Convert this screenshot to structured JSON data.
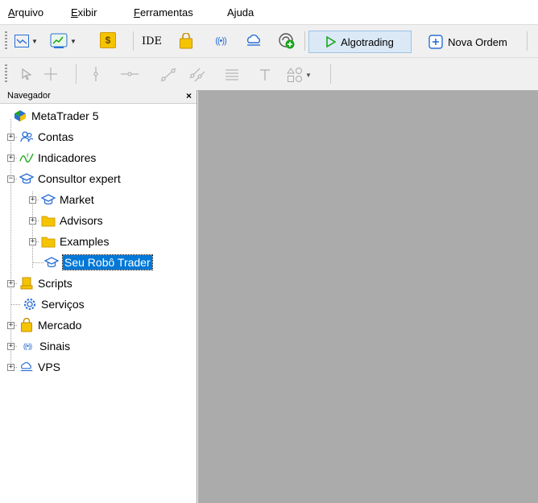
{
  "menu": {
    "arquivo": {
      "u": "A",
      "rest": "rquivo"
    },
    "exibir": {
      "u": "E",
      "rest": "xibir"
    },
    "ferramentas": {
      "u": "F",
      "rest": "erramentas"
    },
    "ajuda": {
      "pre": "A",
      "u": "j",
      "rest": "uda"
    }
  },
  "toolbar": {
    "ide_label": "IDE",
    "algotrading_label": "Algotrading",
    "nova_ordem_label": "Nova Ordem",
    "dollar_glyph": "$"
  },
  "navigator": {
    "title": "Navegador",
    "close": "×",
    "items": [
      {
        "label": "MetaTrader 5"
      },
      {
        "label": "Contas"
      },
      {
        "label": "Indicadores"
      },
      {
        "label": "Consultor expert"
      },
      {
        "label": "Market"
      },
      {
        "label": "Advisors"
      },
      {
        "label": "Examples"
      },
      {
        "label": "Seu Robô Trader"
      },
      {
        "label": "Scripts"
      },
      {
        "label": "Serviços"
      },
      {
        "label": "Mercado"
      },
      {
        "label": "Sinais"
      },
      {
        "label": "VPS"
      }
    ]
  },
  "colors": {
    "selection": "#0078d7",
    "chart_bg": "#ababab",
    "folder": "#f5c400",
    "algotrading_green": "#1aa51a"
  }
}
